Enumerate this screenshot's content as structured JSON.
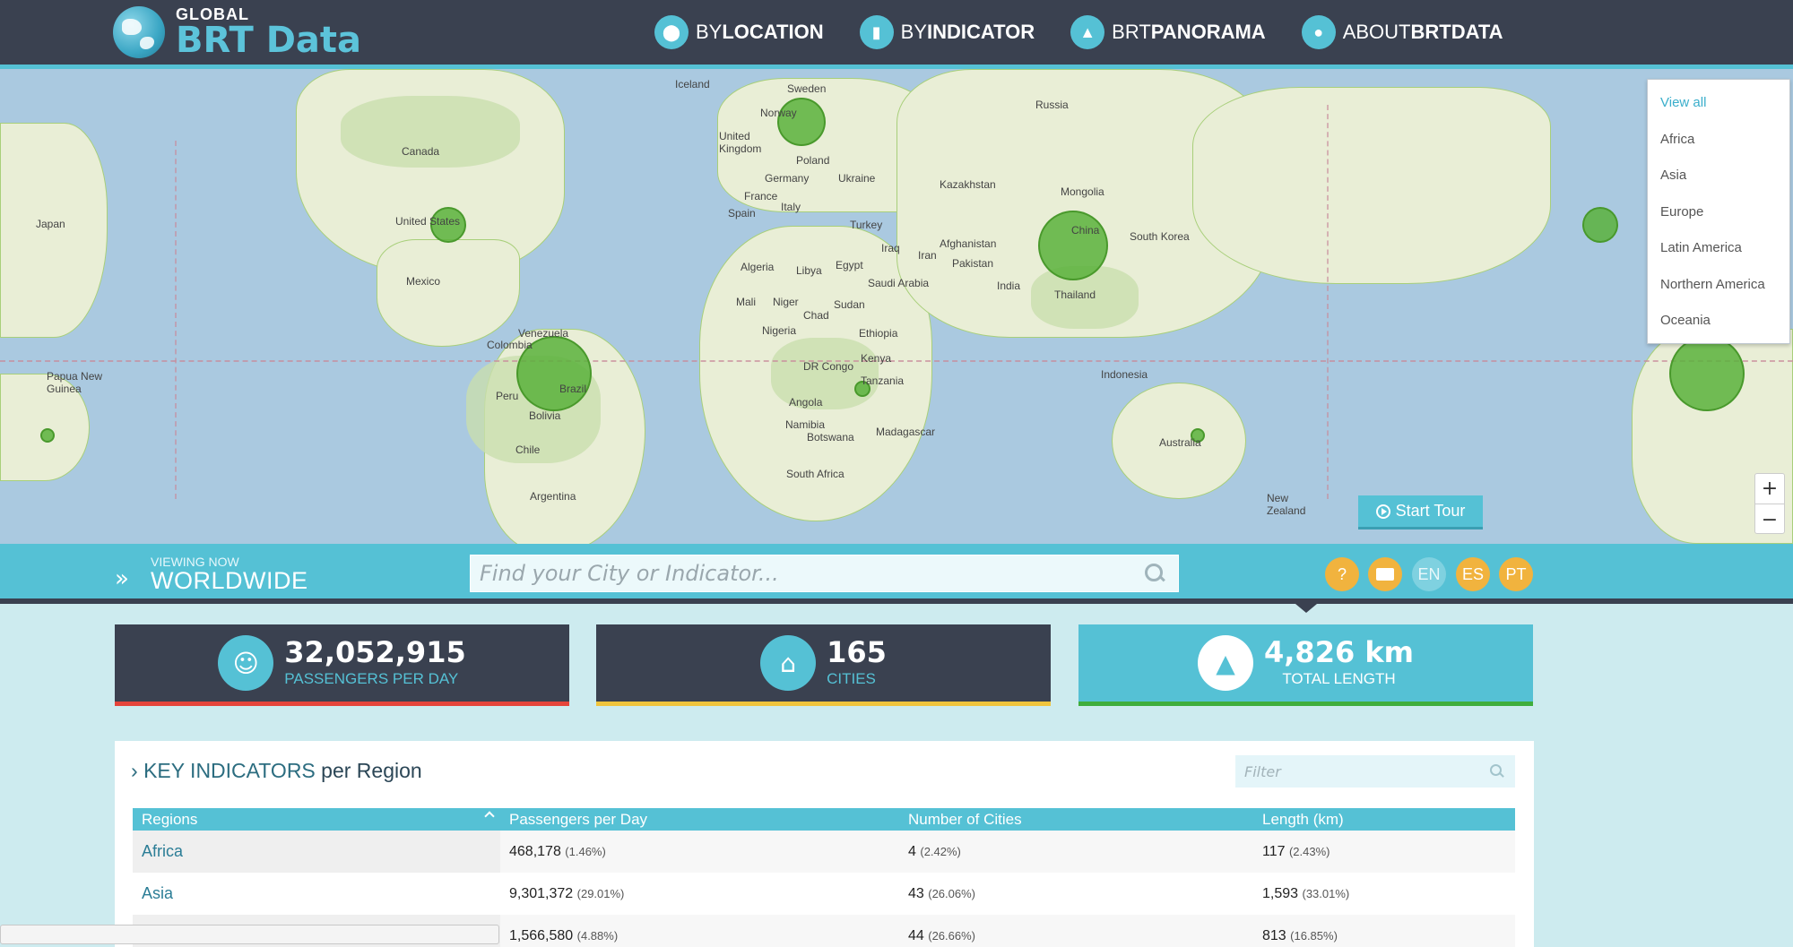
{
  "header": {
    "logo_small": "GLOBAL",
    "logo_big": "BRT Data",
    "nav": [
      {
        "light": "BY ",
        "bold": "LOCATION",
        "icon": "location-pin-icon"
      },
      {
        "light": "BY ",
        "bold": "INDICATOR",
        "icon": "bar-signal-icon"
      },
      {
        "light": "BRT ",
        "bold": "PANORAMA",
        "icon": "area-chart-icon"
      },
      {
        "light": "ABOUT ",
        "bold": "BRTDATA",
        "icon": "chat-bubbles-icon"
      }
    ]
  },
  "map": {
    "countries": [
      "Iceland",
      "Sweden",
      "Norway",
      "Russia",
      "Canada",
      "United Kingdom",
      "Poland",
      "Germany",
      "Ukraine",
      "Kazakhstan",
      "Mongolia",
      "France",
      "Italy",
      "Spain",
      "Turkey",
      "United States",
      "Japan",
      "South Korea",
      "China",
      "Afghanistan",
      "Iran",
      "Iraq",
      "Pakistan",
      "India",
      "Egypt",
      "Libya",
      "Algeria",
      "Saudi Arabia",
      "Mexico",
      "Thailand",
      "Mali",
      "Niger",
      "Sudan",
      "Chad",
      "Nigeria",
      "Ethiopia",
      "Venezuela",
      "Colombia",
      "Kenya",
      "DR Congo",
      "Tanzania",
      "Indonesia",
      "Papua New Guinea",
      "Peru",
      "Brazil",
      "Angola",
      "Bolivia",
      "Namibia",
      "Botswana",
      "Madagascar",
      "Australia",
      "Chile",
      "South Africa",
      "New Zealand",
      "Argentina"
    ],
    "region_menu": [
      "View all",
      "Africa",
      "Asia",
      "Europe",
      "Latin America",
      "Northern America",
      "Oceania"
    ],
    "zoom_in": "+",
    "zoom_out": "−",
    "start_tour": "Start Tour"
  },
  "viewbar": {
    "viewing_label": "VIEWING NOW",
    "viewing_value": "WORLDWIDE",
    "search_placeholder": "Find your City or Indicator...",
    "help": "?",
    "lang": [
      "EN",
      "ES",
      "PT"
    ]
  },
  "stats": [
    {
      "value": "32,052,915",
      "label": "PASSENGERS PER DAY",
      "color": "#e5443a",
      "icon": "people-icon"
    },
    {
      "value": "165",
      "label": "CITIES",
      "color": "#f0c43c",
      "icon": "home-icon"
    },
    {
      "value": "4,826 km",
      "label": "TOTAL LENGTH",
      "color": "#3fae3c",
      "icon": "road-icon"
    }
  ],
  "table": {
    "title_main": "KEY INDICATORS",
    "title_sub": "per Region",
    "filter_placeholder": "Filter",
    "headers": [
      "Regions",
      "Passengers per Day",
      "Number of Cities",
      "Length (km)"
    ],
    "rows": [
      {
        "region": "Africa",
        "pax": "468,178",
        "pax_pct": "(1.46%)",
        "cities": "4",
        "cities_pct": "(2.42%)",
        "length": "117",
        "length_pct": "(2.43%)"
      },
      {
        "region": "Asia",
        "pax": "9,301,372",
        "pax_pct": "(29.01%)",
        "cities": "43",
        "cities_pct": "(26.06%)",
        "length": "1,593",
        "length_pct": "(33.01%)"
      },
      {
        "region": "",
        "pax": "1,566,580",
        "pax_pct": "(4.88%)",
        "cities": "44",
        "cities_pct": "(26.66%)",
        "length": "813",
        "length_pct": "(16.85%)"
      }
    ]
  },
  "colors": {
    "dark": "#3a4150",
    "teal": "#55c1d5",
    "orange": "#f1b33e",
    "bubble": "#5ab23c"
  }
}
